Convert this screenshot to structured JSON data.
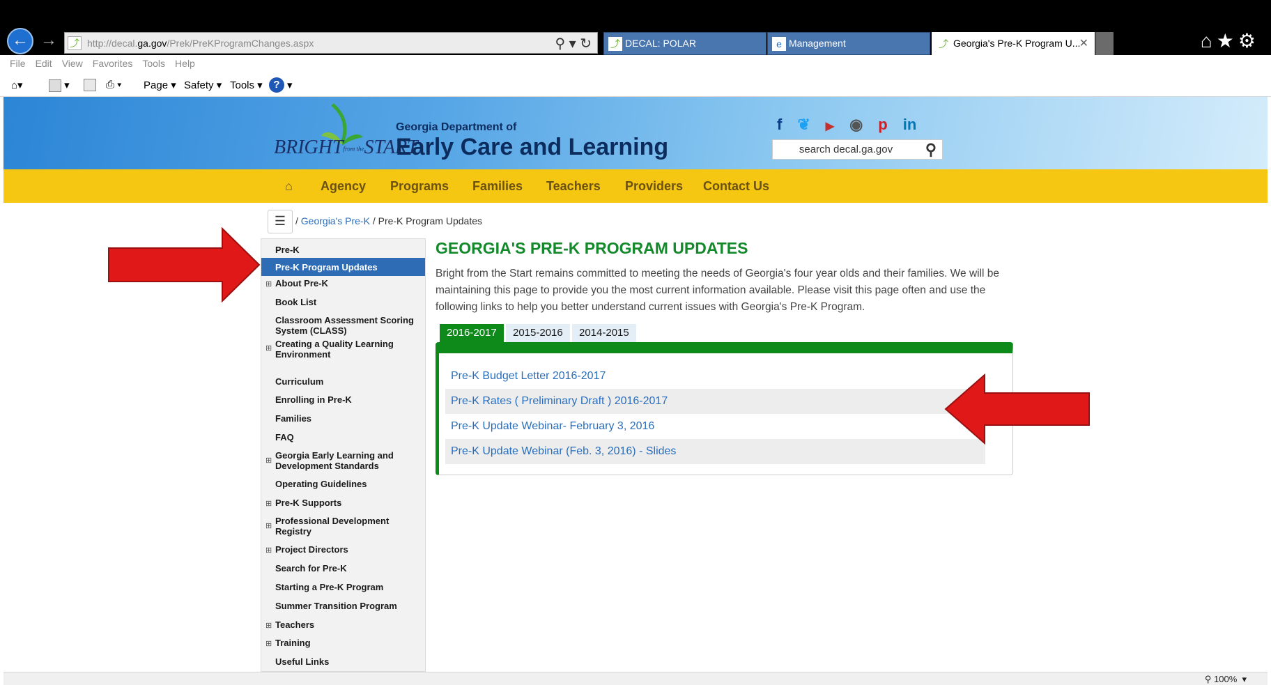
{
  "browser": {
    "url_prefix": "http://decal.",
    "url_domain": "ga.gov",
    "url_path": "/Prek/PreKProgramChanges.aspx",
    "tabs": [
      {
        "label": "DECAL: POLAR"
      },
      {
        "label": "Management"
      },
      {
        "label": "Georgia's Pre-K Program U..."
      }
    ],
    "menu": [
      "File",
      "Edit",
      "View",
      "Favorites",
      "Tools",
      "Help"
    ],
    "commands": {
      "page": "Page ▾",
      "safety": "Safety ▾",
      "tools": "Tools ▾"
    },
    "zoom": "100%"
  },
  "header": {
    "logo_text": "BRIGHT",
    "logo_small": "from the",
    "logo_text2": "START",
    "dept_small": "Georgia Department of",
    "dept_big": "Early Care and Learning",
    "search_placeholder": "search decal.ga.gov"
  },
  "nav": {
    "items": [
      "Agency",
      "Programs",
      "Families",
      "Teachers",
      "Providers",
      "Contact Us"
    ]
  },
  "breadcrumb": {
    "sep": " / ",
    "link": "Georgia's Pre-K",
    "current": "Pre-K Program Updates"
  },
  "sidebar": {
    "items": [
      {
        "label": "Pre-K",
        "expandable": false
      },
      {
        "label": "Pre-K Program Updates",
        "expandable": false,
        "active": true
      },
      {
        "label": "About Pre-K",
        "expandable": true
      },
      {
        "label": "Book List",
        "expandable": false
      },
      {
        "label": "Classroom Assessment Scoring System (CLASS)",
        "expandable": false
      },
      {
        "label": "Creating a Quality Learning Environment",
        "expandable": true
      },
      {
        "label": "Curriculum",
        "expandable": false
      },
      {
        "label": "Enrolling in Pre-K",
        "expandable": false
      },
      {
        "label": "Families",
        "expandable": false
      },
      {
        "label": "FAQ",
        "expandable": false
      },
      {
        "label": "Georgia Early Learning and Development Standards",
        "expandable": true
      },
      {
        "label": "Operating Guidelines",
        "expandable": false
      },
      {
        "label": "Pre-K Supports",
        "expandable": true
      },
      {
        "label": "Professional Development Registry",
        "expandable": true
      },
      {
        "label": "Project Directors",
        "expandable": true
      },
      {
        "label": "Search for Pre-K",
        "expandable": false
      },
      {
        "label": "Starting a Pre-K Program",
        "expandable": false
      },
      {
        "label": "Summer Transition Program",
        "expandable": false
      },
      {
        "label": "Teachers",
        "expandable": true
      },
      {
        "label": "Training",
        "expandable": true
      },
      {
        "label": "Useful Links",
        "expandable": false
      }
    ]
  },
  "main": {
    "title": "GEORGIA'S PRE-K PROGRAM UPDATES",
    "intro": "Bright from the Start remains committed to meeting the needs of Georgia's four year olds and their families. We will be maintaining this page to provide you the most current information available. Please visit this page often and use the following links to help you better understand current issues with Georgia's Pre-K Program.",
    "year_tabs": [
      {
        "label": "2016-2017",
        "active": true
      },
      {
        "label": "2015-2016",
        "active": false
      },
      {
        "label": "2014-2015",
        "active": false
      }
    ],
    "links": [
      "Pre-K Budget Letter 2016-2017",
      "Pre-K Rates ( Preliminary Draft ) 2016-2017",
      "Pre-K Update Webinar- February 3, 2016",
      "Pre-K Update Webinar (Feb. 3, 2016) - Slides"
    ]
  },
  "colors": {
    "accent_green": "#14892c",
    "nav_yellow": "#f6c712",
    "link_blue": "#2a6ebb",
    "active_blue": "#2e6db5",
    "arrow_red": "#e01818"
  }
}
